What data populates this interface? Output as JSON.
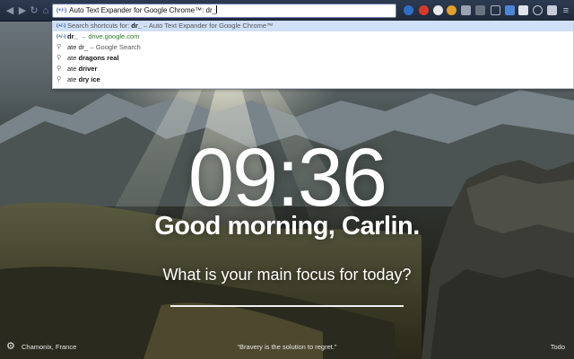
{
  "omnibox": {
    "ext_badge": "(+/-)",
    "text": "Auto Text Expander for Google Chrome™: dr_"
  },
  "suggestions": [
    {
      "icon": "(+/-)",
      "prefix": "Search shortcuts for: ",
      "bold": "dr_",
      "sep": " – ",
      "rest": "Auto Text Expander for Google Chrome™"
    },
    {
      "icon": "(+/-)",
      "bold": "dr_",
      "sep": " → ",
      "url": "drive.google.com"
    },
    {
      "icon": "⚲",
      "plain": "ate dr_",
      "sep": " – ",
      "rest": "Google Search"
    },
    {
      "icon": "⚲",
      "plain": "ate ",
      "bold": "dragons real"
    },
    {
      "icon": "⚲",
      "plain": "ate ",
      "bold": "driver"
    },
    {
      "icon": "⚲",
      "plain": "ate ",
      "bold": "dry ice"
    }
  ],
  "main": {
    "time": "09:36",
    "greeting": "Good morning, Carlin.",
    "focus_prompt": "What is your main focus for today?",
    "focus_value": ""
  },
  "footer": {
    "location": "Chamonix, France",
    "quote": "“Bravery is the solution to regret.”",
    "todo": "Todo"
  },
  "colors": {
    "toolbar": "#24304a",
    "selected_suggestion": "#cfe0f7",
    "url_green": "#2a7a2a"
  }
}
